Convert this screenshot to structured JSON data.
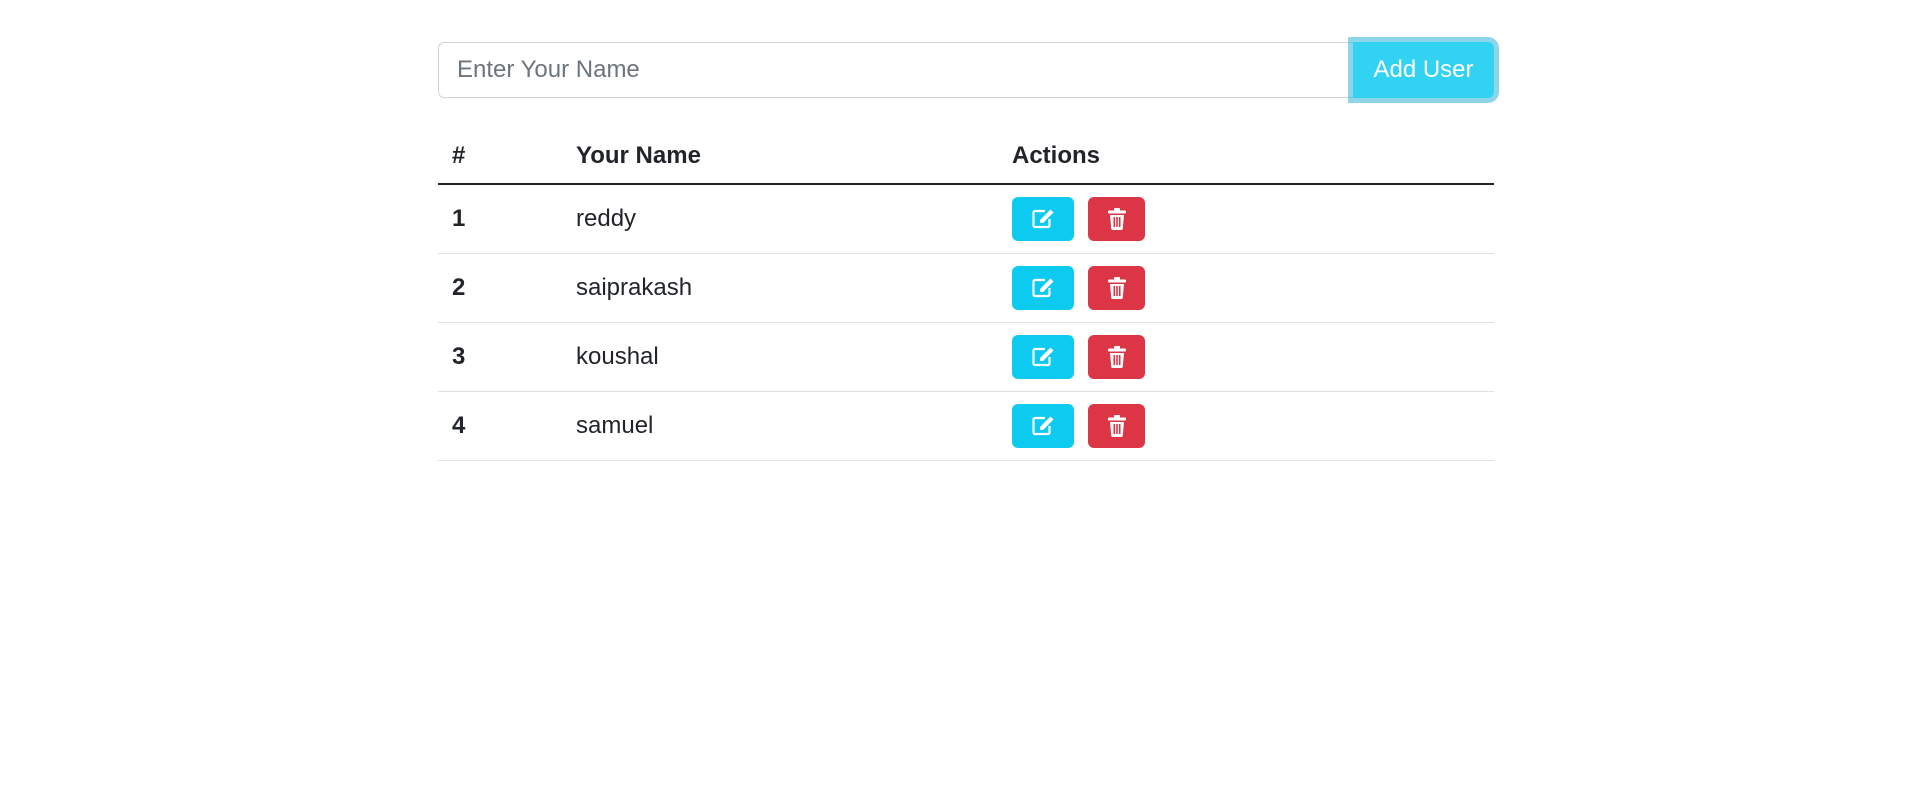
{
  "form": {
    "input_placeholder": "Enter Your Name",
    "input_value": "",
    "add_button_label": "Add User"
  },
  "table": {
    "headers": [
      "#",
      "Your Name",
      "Actions"
    ],
    "rows": [
      {
        "num": "1",
        "name": "reddy"
      },
      {
        "num": "2",
        "name": "saiprakash"
      },
      {
        "num": "3",
        "name": "koushal"
      },
      {
        "num": "4",
        "name": "samuel"
      }
    ]
  },
  "icons": {
    "edit": "edit-icon",
    "delete": "trash-icon"
  },
  "colors": {
    "add_button": "#31d2f2",
    "edit_button": "#0dcaf0",
    "delete_button": "#dc3545"
  }
}
